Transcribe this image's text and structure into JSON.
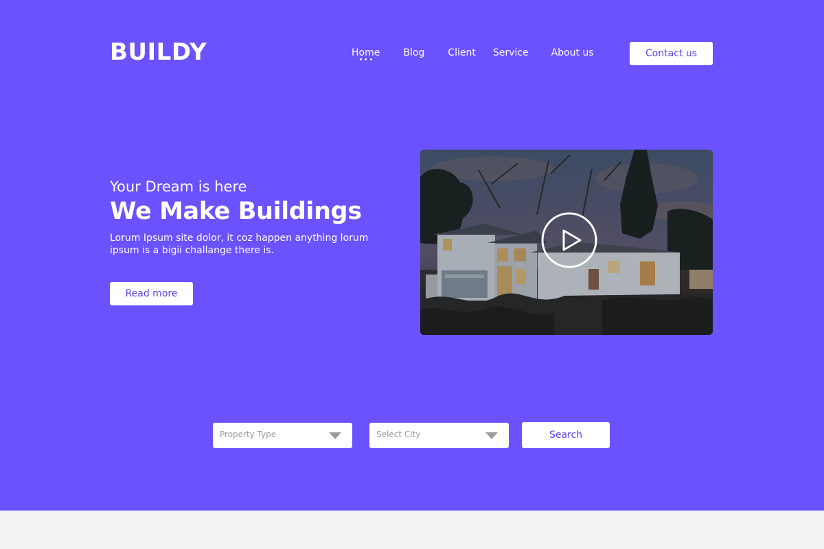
{
  "brand": {
    "logo": "BUILDY"
  },
  "nav": {
    "items": [
      {
        "label": "Home",
        "active": true
      },
      {
        "label": "Blog"
      },
      {
        "label": "Client"
      },
      {
        "label": "Service"
      },
      {
        "label": "About us"
      }
    ],
    "contact_label": "Contact us"
  },
  "hero": {
    "kicker": "Your Dream is here",
    "headline": "We Make Buildings",
    "description": "Lorum Ipsum site dolor, it coz happen anything lorum ipsum is a bigii challange there is.",
    "cta_label": "Read more",
    "video_icon": "play-icon"
  },
  "search": {
    "property_type_placeholder": "Property Type",
    "city_placeholder": "Select City",
    "button_label": "Search"
  },
  "colors": {
    "hero_background": "#6a52fe",
    "button_text": "#5b43f0",
    "page_background": "#f3f3f5"
  }
}
